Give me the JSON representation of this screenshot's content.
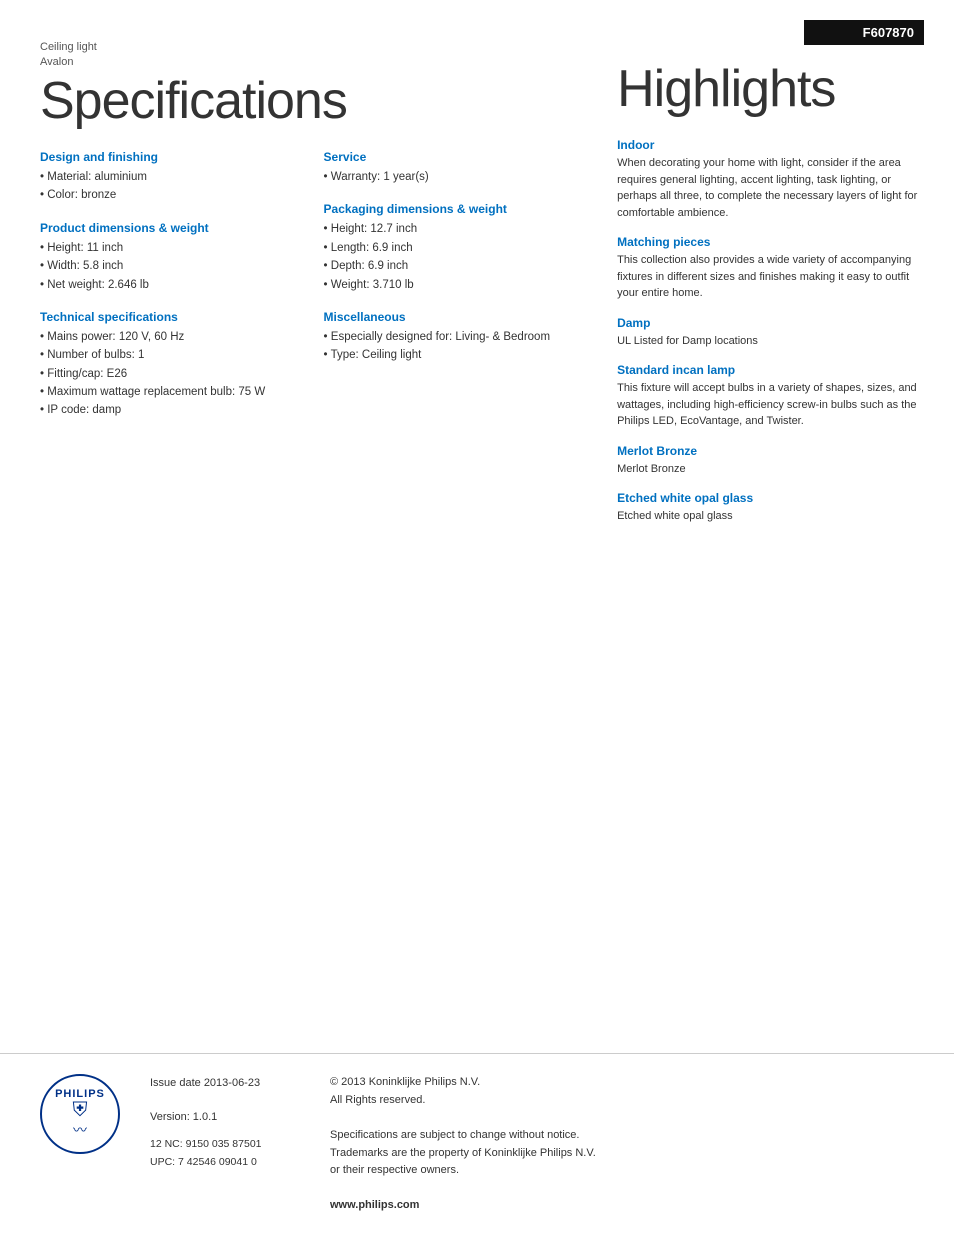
{
  "header": {
    "category": "Ceiling light",
    "product_name": "Avalon",
    "page_title": "Specifications",
    "product_code": "F607870",
    "highlights_title": "Highlights"
  },
  "left": {
    "design_finishing": {
      "title": "Design and finishing",
      "items": [
        "Material: aluminium",
        "Color: bronze"
      ]
    },
    "product_dimensions": {
      "title": "Product dimensions & weight",
      "items": [
        "Height: 11 inch",
        "Width: 5.8 inch",
        "Net weight: 2.646 lb"
      ]
    },
    "technical_specifications": {
      "title": "Technical specifications",
      "items": [
        "Mains power: 120 V, 60 Hz",
        "Number of bulbs: 1",
        "Fitting/cap: E26",
        "Maximum wattage replacement bulb: 75 W",
        "IP code: damp"
      ]
    },
    "service": {
      "title": "Service",
      "items": [
        "Warranty: 1 year(s)"
      ]
    },
    "packaging_dimensions": {
      "title": "Packaging dimensions & weight",
      "items": [
        "Height: 12.7 inch",
        "Length: 6.9 inch",
        "Depth: 6.9 inch",
        "Weight: 3.710 lb"
      ]
    },
    "miscellaneous": {
      "title": "Miscellaneous",
      "items": [
        "Especially designed for: Living- & Bedroom",
        "Type: Ceiling light"
      ]
    }
  },
  "right": {
    "indoor": {
      "title": "Indoor",
      "text": "When decorating your home with light, consider if the area requires general lighting, accent lighting, task lighting, or perhaps all three, to complete the necessary layers of light for comfortable ambience."
    },
    "matching_pieces": {
      "title": "Matching pieces",
      "text": "This collection also provides a wide variety of accompanying fixtures in different sizes and finishes making it easy to outfit your entire home."
    },
    "damp": {
      "title": "Damp",
      "text": "UL Listed for Damp locations"
    },
    "standard_incan_lamp": {
      "title": "Standard incan lamp",
      "text": "This fixture will accept bulbs in a variety of shapes, sizes, and wattages, including high-efficiency screw-in bulbs such as the Philips LED, EcoVantage, and Twister."
    },
    "merlot_bronze": {
      "title": "Merlot Bronze",
      "text": "Merlot Bronze"
    },
    "etched_white_opal_glass": {
      "title": "Etched white opal glass",
      "text": "Etched white opal glass"
    }
  },
  "footer": {
    "issue_date_label": "Issue date 2013-06-23",
    "version_label": "Version: 1.0.1",
    "nc_upc": "12 NC: 9150 035 87501\nUPC: 7 42546 09041 0",
    "copyright": "© 2013 Koninklijke Philips N.V.\nAll Rights reserved.",
    "disclaimer": "Specifications are subject to change without notice.\nTrademarks are the property of Koninklijke Philips N.V.\nor their respective owners.",
    "website": "www.philips.com"
  }
}
